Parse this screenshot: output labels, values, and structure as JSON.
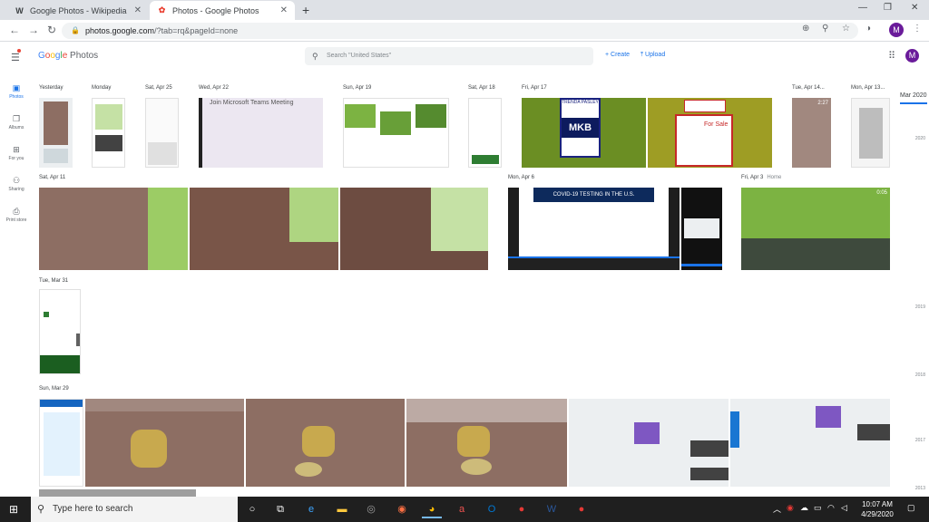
{
  "browser": {
    "tabs": [
      {
        "favicon": "W",
        "title": "Google Photos - Wikipedia"
      },
      {
        "favicon": "✿",
        "title": "Photos - Google Photos"
      }
    ],
    "url_host": "photos.google.com",
    "url_path": "/?tab=rq&pageId=none",
    "profile_initial": "M"
  },
  "app": {
    "logo_parts": [
      "G",
      "o",
      "o",
      "g",
      "l",
      "e"
    ],
    "logo_suffix": "Photos",
    "search_placeholder": "Search \"United States\"",
    "create_label": "+ Create",
    "upload_label": "⤒ Upload",
    "avatar_initial": "M"
  },
  "sidebar": [
    {
      "icon": "photos-icon",
      "glyph": "▣",
      "label": "Photos",
      "active": true
    },
    {
      "icon": "albums-icon",
      "glyph": "❐",
      "label": "Albums"
    },
    {
      "icon": "for-you-icon",
      "glyph": "⊞",
      "label": "For you"
    },
    {
      "icon": "sharing-icon",
      "glyph": "⚇",
      "label": "Sharing"
    },
    {
      "icon": "print-store-icon",
      "glyph": "⎙",
      "label": "Print store"
    }
  ],
  "timeline": {
    "dates": [
      {
        "label": "Yesterday"
      },
      {
        "label": "Monday"
      },
      {
        "label": "Sat, Apr 25"
      },
      {
        "label": "Wed, Apr 22"
      },
      {
        "label": "Sun, Apr 19"
      },
      {
        "label": "Sat, Apr 18"
      },
      {
        "label": "Fri, Apr 17"
      },
      {
        "label": "Tue, Apr 14..."
      },
      {
        "label": "Mon, Apr 13..."
      },
      {
        "label": "Sat, Apr 11"
      },
      {
        "label": "Mon, Apr 6"
      },
      {
        "label": "Fri, Apr 3",
        "location": "Home"
      },
      {
        "label": "Tue, Mar 31"
      },
      {
        "label": "Sun, Mar 29"
      }
    ],
    "video_durations": [
      "2:27",
      "0:05"
    ],
    "thumb_texts": {
      "teams": "Join Microsoft Teams Meeting",
      "mkb": "MKB",
      "sign_name": "TRENDA PASLEY",
      "remax": "For Sale",
      "covid": "COVID-19 TESTING IN THE U.S."
    }
  },
  "scrubber": {
    "current": "Mar 2020",
    "years": [
      "2020",
      "2019",
      "2018",
      "2017",
      "2013"
    ]
  },
  "taskbar": {
    "search_placeholder": "Type here to search",
    "time": "10:07 AM",
    "date": "4/29/2020"
  }
}
